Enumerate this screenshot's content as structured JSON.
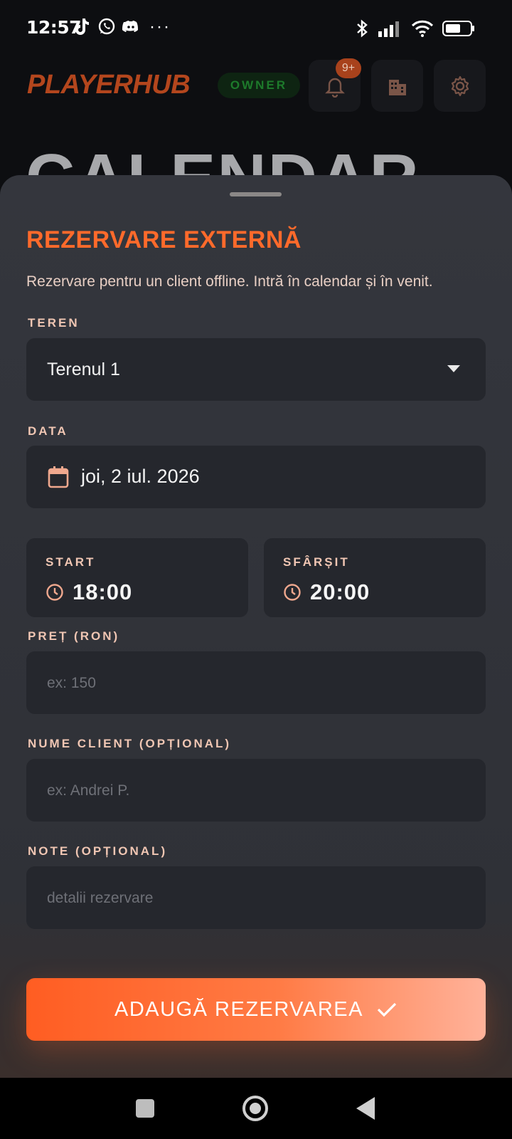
{
  "status_bar": {
    "time": "12:57",
    "left_icons": [
      "tiktok-icon",
      "whatsapp-icon",
      "discord-icon"
    ],
    "overflow": "···",
    "right_icons": [
      "bluetooth-icon",
      "signal-icon",
      "wifi-icon",
      "battery-icon"
    ]
  },
  "header": {
    "logo": "PLAYERHUB",
    "role_badge": "OWNER",
    "notification_count": "9+",
    "buttons": [
      "bell-icon",
      "building-icon",
      "gear-icon"
    ]
  },
  "background": {
    "page_title": "CALENDAR"
  },
  "sheet": {
    "title": "REZERVARE EXTERNĂ",
    "subtitle": "Rezervare pentru un client offline. Intră în calendar și în venit.",
    "court": {
      "label": "TEREN",
      "value": "Terenul 1"
    },
    "date": {
      "label": "DATA",
      "value": "joi, 2 iul. 2026"
    },
    "start": {
      "label": "START",
      "value": "18:00"
    },
    "end": {
      "label": "SFÂRȘIT",
      "value": "20:00"
    },
    "price": {
      "label": "PREȚ (RON)",
      "placeholder": "ex: 150"
    },
    "client": {
      "label": "NUME CLIENT (OPȚIONAL)",
      "placeholder": "ex: Andrei P."
    },
    "notes": {
      "label": "NOTE (OPȚIONAL)",
      "placeholder": "detalii rezervare"
    },
    "submit_label": "ADAUGĂ REZERVAREA"
  },
  "colors": {
    "accent": "#ff6a2b",
    "label": "#f0c6b3",
    "sheet_bg": "#34363d",
    "field_bg": "#25272d",
    "owner_green": "#1d7a2b"
  },
  "nav": [
    "recents-button",
    "home-button",
    "back-button"
  ]
}
